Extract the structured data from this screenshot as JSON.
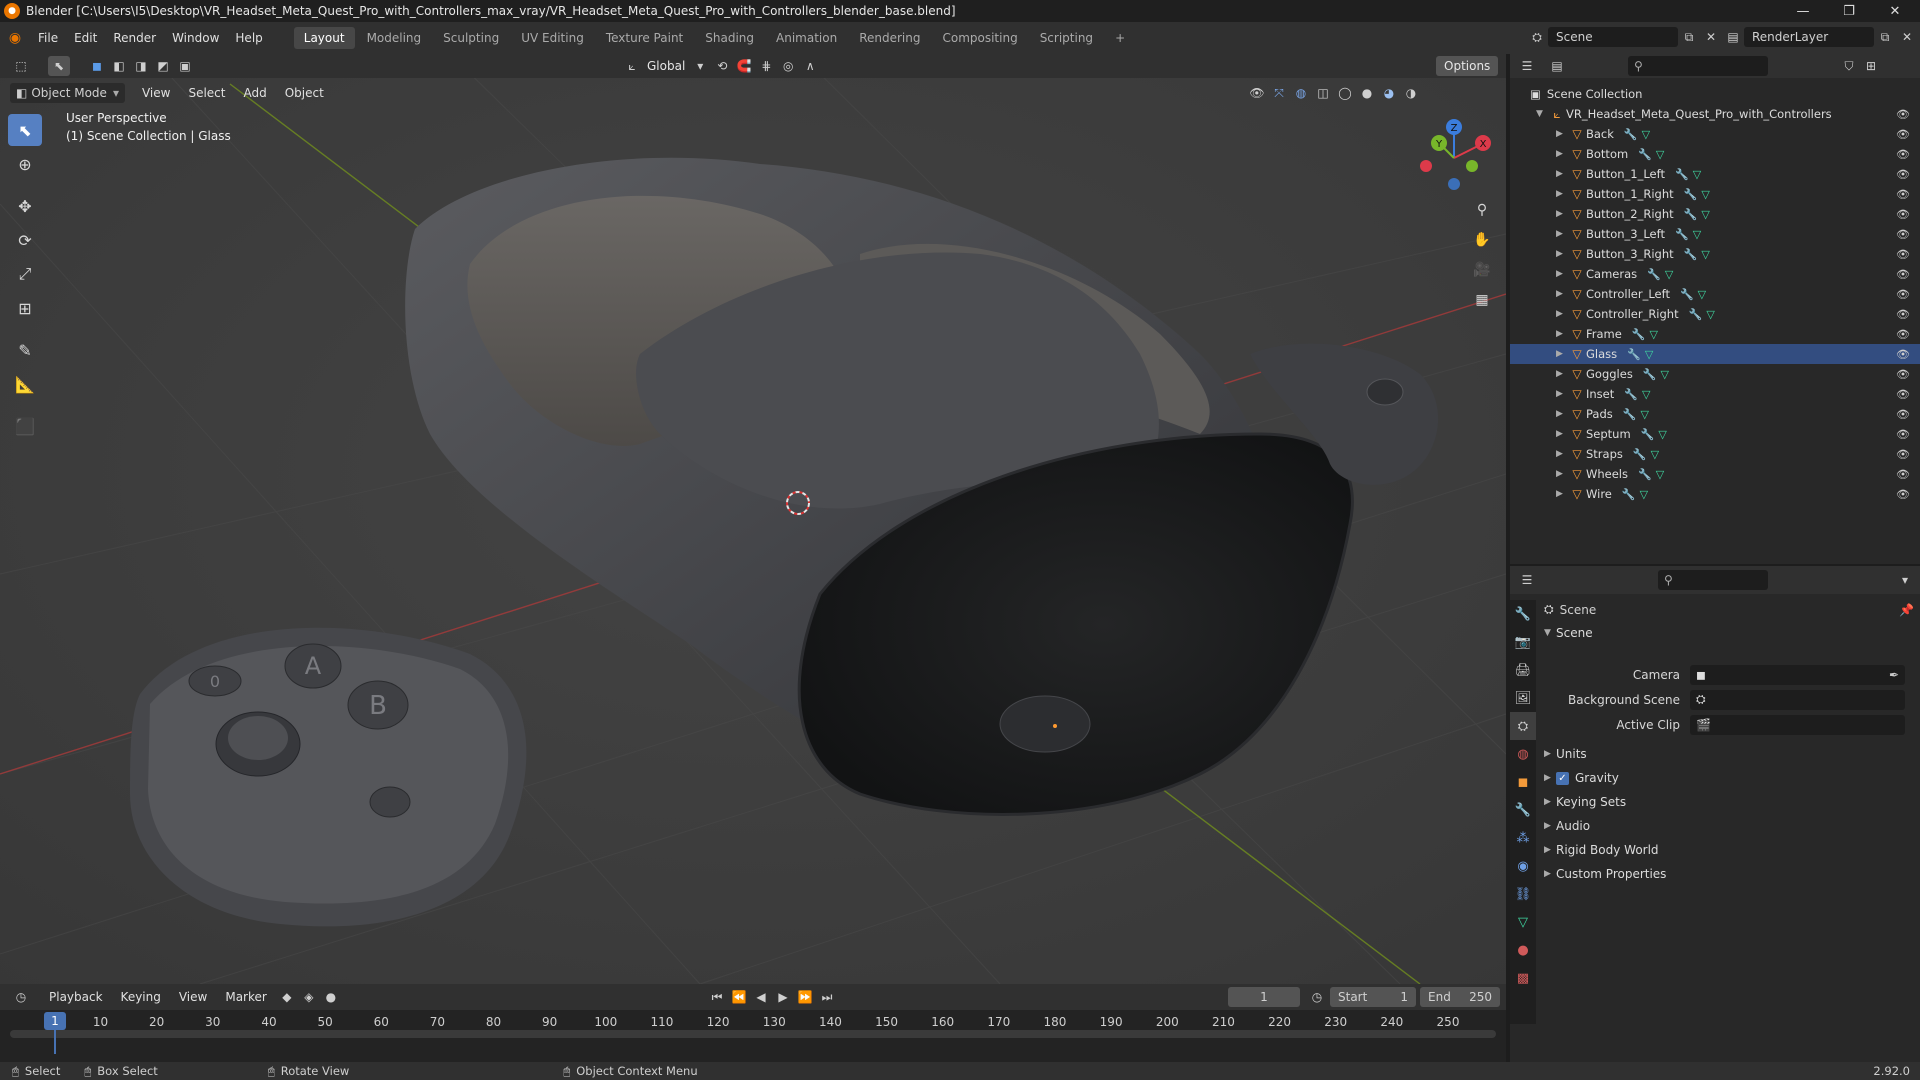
{
  "window": {
    "title": "Blender [C:\\Users\\I5\\Desktop\\VR_Headset_Meta_Quest_Pro_with_Controllers_max_vray/VR_Headset_Meta_Quest_Pro_with_Controllers_blender_base.blend]",
    "minimize": "—",
    "maximize": "❐",
    "close": "✕"
  },
  "menubar": {
    "items": [
      "File",
      "Edit",
      "Render",
      "Window",
      "Help"
    ],
    "workspaces": [
      "Layout",
      "Modeling",
      "Sculpting",
      "UV Editing",
      "Texture Paint",
      "Shading",
      "Animation",
      "Rendering",
      "Compositing",
      "Scripting"
    ],
    "active_workspace": "Layout",
    "add_tab": "+",
    "scene_label": "Scene",
    "renderlayer_label": "RenderLayer"
  },
  "viewport_header": {
    "transform_orientation": "Global",
    "options": "Options",
    "mode": "Object Mode",
    "menus": [
      "View",
      "Select",
      "Add",
      "Object"
    ]
  },
  "viewport": {
    "perspective": "User Perspective",
    "collection_info": "(1) Scene Collection | Glass",
    "controller_buttons": {
      "a": "A",
      "b": "B",
      "menu": "0"
    },
    "gizmo_labels": {
      "x": "X",
      "y": "Y",
      "z": "Z"
    }
  },
  "outliner": {
    "root": "Scene Collection",
    "collection": "VR_Headset_Meta_Quest_Pro_with_Controllers",
    "items": [
      "Back",
      "Bottom",
      "Button_1_Left",
      "Button_1_Right",
      "Button_2_Right",
      "Button_3_Left",
      "Button_3_Right",
      "Cameras",
      "Controller_Left",
      "Controller_Right",
      "Frame",
      "Glass",
      "Goggles",
      "Inset",
      "Pads",
      "Septum",
      "Straps",
      "Wheels",
      "Wire"
    ],
    "selected": "Glass"
  },
  "properties": {
    "context_title": "Scene",
    "section_title": "Scene",
    "fields": [
      {
        "label": "Camera",
        "value": ""
      },
      {
        "label": "Background Scene",
        "value": ""
      },
      {
        "label": "Active Clip",
        "value": ""
      }
    ],
    "subsections": [
      {
        "label": "Units",
        "checkbox": false
      },
      {
        "label": "Gravity",
        "checkbox": true
      },
      {
        "label": "Keying Sets",
        "checkbox": false
      },
      {
        "label": "Audio",
        "checkbox": false
      },
      {
        "label": "Rigid Body World",
        "checkbox": false
      },
      {
        "label": "Custom Properties",
        "checkbox": false
      }
    ]
  },
  "timeline": {
    "menus": [
      "Playback",
      "Keying",
      "View",
      "Marker"
    ],
    "current_frame": "1",
    "start_label": "Start",
    "start_value": "1",
    "end_label": "End",
    "end_value": "250",
    "playhead_label": "1",
    "ticks": [
      "10",
      "20",
      "30",
      "40",
      "50",
      "60",
      "70",
      "80",
      "90",
      "100",
      "110",
      "120",
      "130",
      "140",
      "150",
      "160",
      "170",
      "180",
      "190",
      "200",
      "210",
      "220",
      "230",
      "240",
      "250"
    ]
  },
  "statusbar": {
    "select": "Select",
    "box_select": "Box Select",
    "rotate_view": "Rotate View",
    "context_menu": "Object Context Menu",
    "version": "2.92.0"
  },
  "colors": {
    "accent": "#5680c2",
    "selection": "#334d80",
    "object_icon": "#f39a3a",
    "mesh_icon": "#3fd6a0"
  }
}
